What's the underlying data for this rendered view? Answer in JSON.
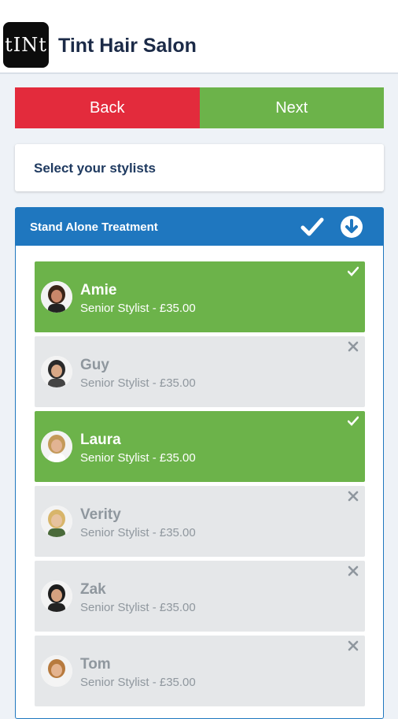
{
  "app": {
    "logo_text": "tINt",
    "title": "Tint Hair Salon"
  },
  "nav": {
    "back_label": "Back",
    "next_label": "Next"
  },
  "prompt": "Select your stylists",
  "section": {
    "title": "Stand Alone Treatment",
    "header_icons": [
      "check-icon",
      "arrow-down-circle-icon"
    ]
  },
  "stylists": [
    {
      "name": "Amie",
      "role": "Senior Stylist - £35.00",
      "selected": true
    },
    {
      "name": "Guy",
      "role": "Senior Stylist - £35.00",
      "selected": false
    },
    {
      "name": "Laura",
      "role": "Senior Stylist - £35.00",
      "selected": true
    },
    {
      "name": "Verity",
      "role": "Senior Stylist - £35.00",
      "selected": false
    },
    {
      "name": "Zak",
      "role": "Senior Stylist - £35.00",
      "selected": false
    },
    {
      "name": "Tom",
      "role": "Senior Stylist - £35.00",
      "selected": false
    }
  ],
  "colors": {
    "back": "#e32b3c",
    "next": "#6cb34a",
    "selected": "#6cb34a",
    "unselected": "#e5e7e9",
    "header_blue": "#1f77bf"
  }
}
